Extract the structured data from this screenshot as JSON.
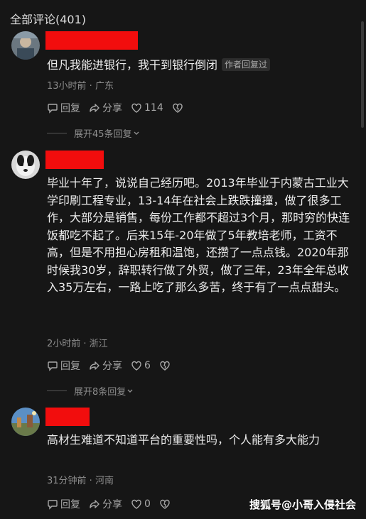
{
  "header": {
    "title": "全部评论(401)"
  },
  "comments": [
    {
      "text": "但凡我能进银行，我干到银行倒闭",
      "author_tag": "作者回复过",
      "meta": "13小时前 · 广东",
      "reply_label": "回复",
      "share_label": "分享",
      "like_count": "114",
      "expand_label": "展开45条回复"
    },
    {
      "text": "毕业十年了，说说自己经历吧。2013年毕业于内蒙古工业大学印刷工程专业，13-14年在社会上跌跌撞撞，做了很多工作，大部分是销售，每份工作都不超过3个月，那时穷的快连饭都吃不起了。后来15年-20年做了5年教培老师，工资不高，但是不用担心房租和温饱，还攒了一点点钱。2020年那时候我30岁，辞职转行做了外贸，做了三年，23年全年总收入35万左右，一路上吃了那么多苦，终于有了一点点甜头。",
      "meta": "2小时前 · 浙江",
      "reply_label": "回复",
      "share_label": "分享",
      "like_count": "6",
      "expand_label": "展开8条回复"
    },
    {
      "text": "高材生难道不知道平台的重要性吗，个人能有多大能力",
      "meta": "31分钟前 · 河南",
      "reply_label": "回复",
      "share_label": "分享",
      "like_count": "0"
    }
  ],
  "watermark": "搜狐号@小哥入侵社会",
  "colors": {
    "background": "#161616",
    "redacted_name": "#f20d0d"
  },
  "icons": [
    "reply-icon",
    "share-icon",
    "heart-icon",
    "dislike-icon",
    "chevron-down-icon"
  ]
}
